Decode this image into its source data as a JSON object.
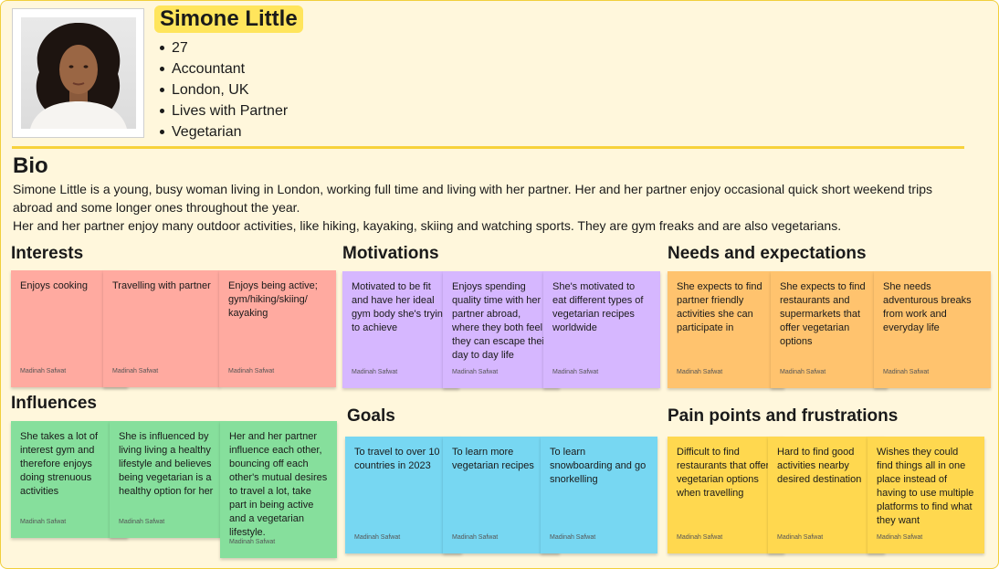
{
  "persona": {
    "name": "Simone Little",
    "facts": [
      "27",
      "Accountant",
      "London, UK",
      "Lives with Partner",
      "Vegetarian"
    ]
  },
  "bio": {
    "title": "Bio",
    "paragraph1": "Simone Little is a young, busy woman living in London, working full time and living with her partner. Her and her partner enjoy occasional quick short weekend trips abroad and some longer ones throughout the year.",
    "paragraph2": "Her and her partner enjoy many outdoor activities, like hiking, kayaking, skiing and watching sports. They are gym freaks and are also vegetarians."
  },
  "sections": {
    "interests": {
      "title": "Interests",
      "notes": [
        {
          "text": "Enjoys cooking",
          "author": "Madinah Safwat"
        },
        {
          "text": "Travelling with partner",
          "author": "Madinah Safwat"
        },
        {
          "text": "Enjoys being active; gym/hiking/skiing/ kayaking",
          "author": "Madinah Safwat"
        }
      ]
    },
    "influences": {
      "title": "Influences",
      "notes": [
        {
          "text": "She takes a lot of interest gym and therefore enjoys doing strenuous activities",
          "author": "Madinah Safwat"
        },
        {
          "text": "She is influenced by living living a healthy lifestyle and believes being vegetarian is a healthy option for her",
          "author": "Madinah Safwat"
        },
        {
          "text": "Her and her partner influence each other, bouncing off each other's mutual desires to travel a lot, take part in being active and a vegetarian lifestyle.",
          "author": "Madinah Safwat"
        }
      ]
    },
    "motivations": {
      "title": "Motivations",
      "notes": [
        {
          "text": "Motivated to be fit and have her ideal gym body she's trying to achieve",
          "author": "Madinah Safwat"
        },
        {
          "text": "Enjoys spending quality time with her partner abroad, where they both feel they can escape their day to day life",
          "author": "Madinah Safwat"
        },
        {
          "text": "She's motivated to eat different types of vegetarian recipes worldwide",
          "author": "Madinah Safwat"
        }
      ]
    },
    "goals": {
      "title": "Goals",
      "notes": [
        {
          "text": "To travel to over 10 countries in 2023",
          "author": "Madinah Safwat"
        },
        {
          "text": "To learn more vegetarian recipes",
          "author": "Madinah Safwat"
        },
        {
          "text": "To learn snowboarding and go snorkelling",
          "author": "Madinah Safwat"
        }
      ]
    },
    "needs": {
      "title": "Needs and expectations",
      "notes": [
        {
          "text": "She expects to find partner friendly activities she can participate in",
          "author": "Madinah Safwat"
        },
        {
          "text": "She expects to find restaurants and supermarkets that offer vegetarian options",
          "author": "Madinah Safwat"
        },
        {
          "text": "She needs adventurous breaks from work and everyday life",
          "author": "Madinah Safwat"
        }
      ]
    },
    "pains": {
      "title": "Pain points and frustrations",
      "notes": [
        {
          "text": "Difficult to find restaurants that offer vegetarian options when travelling",
          "author": "Madinah Safwat"
        },
        {
          "text": "Hard to find good activities nearby desired destination",
          "author": "Madinah Safwat"
        },
        {
          "text": "Wishes they could find things all in one place instead of having to use multiple platforms to find what they want",
          "author": "Madinah Safwat"
        }
      ]
    }
  }
}
